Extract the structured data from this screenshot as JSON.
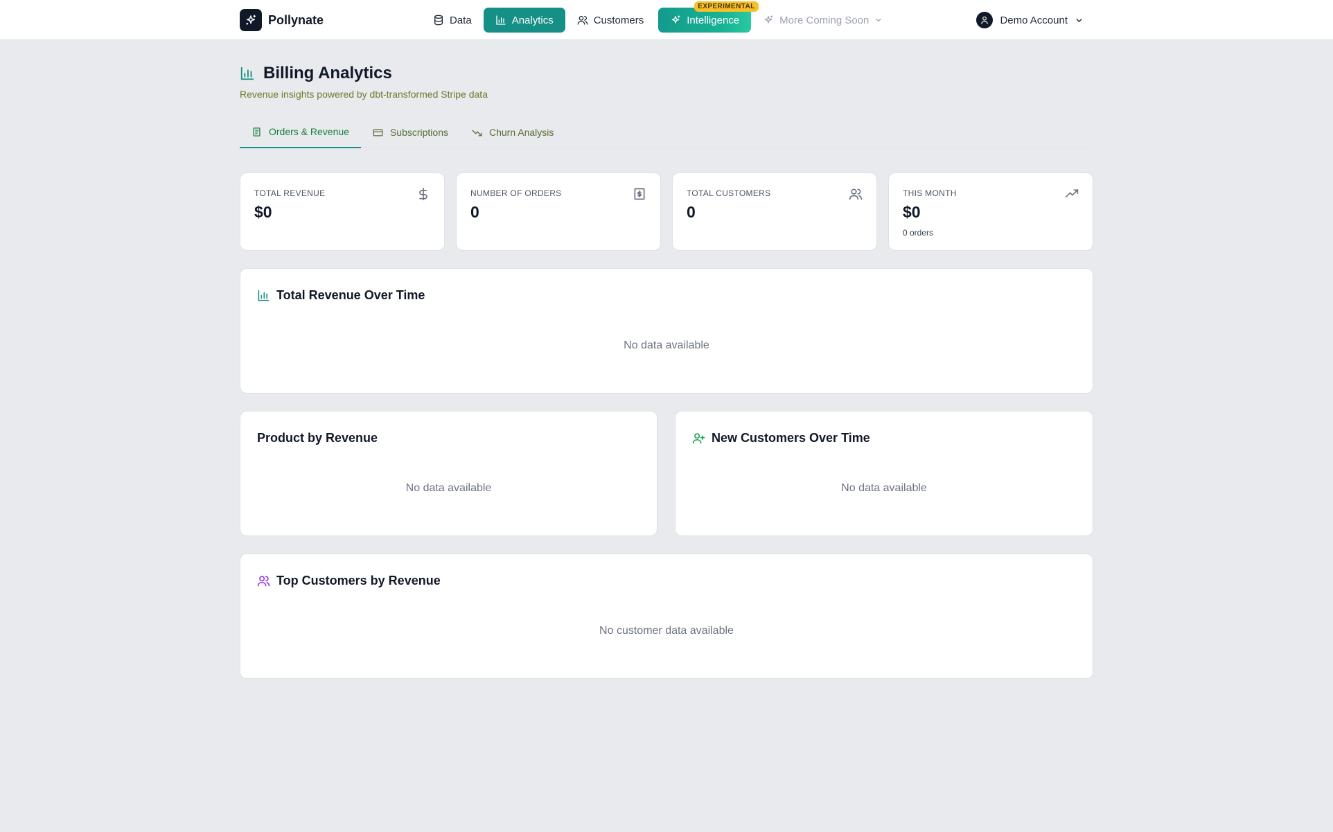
{
  "app": {
    "name": "Pollynate"
  },
  "nav": {
    "data": "Data",
    "analytics": "Analytics",
    "customers": "Customers",
    "intelligence": "Intelligence",
    "intelligence_badge": "EXPERIMENTAL",
    "more": "More Coming Soon"
  },
  "account": {
    "name": "Demo Account"
  },
  "page": {
    "title": "Billing Analytics",
    "subtitle": "Revenue insights powered by dbt-transformed Stripe data"
  },
  "tabs": [
    {
      "label": "Orders & Revenue",
      "active": true
    },
    {
      "label": "Subscriptions",
      "active": false
    },
    {
      "label": "Churn Analysis",
      "active": false
    }
  ],
  "stats": [
    {
      "label": "TOTAL REVENUE",
      "value": "$0",
      "icon": "dollar-icon"
    },
    {
      "label": "NUMBER OF ORDERS",
      "value": "0",
      "icon": "receipt-icon"
    },
    {
      "label": "TOTAL CUSTOMERS",
      "value": "0",
      "icon": "users-icon"
    },
    {
      "label": "THIS MONTH",
      "value": "$0",
      "sub": "0 orders",
      "icon": "trending-up-icon"
    }
  ],
  "panels": {
    "revenue_over_time": {
      "title": "Total Revenue Over Time",
      "empty": "No data available"
    },
    "product_by_revenue": {
      "title": "Product by Revenue",
      "empty": "No data available"
    },
    "new_customers": {
      "title": "New Customers Over Time",
      "empty": "No data available"
    },
    "top_customers": {
      "title": "Top Customers by Revenue",
      "empty": "No customer data available"
    }
  },
  "colors": {
    "accent": "#168f86",
    "badge": "#f5c02a",
    "background": "#e8eaee"
  }
}
